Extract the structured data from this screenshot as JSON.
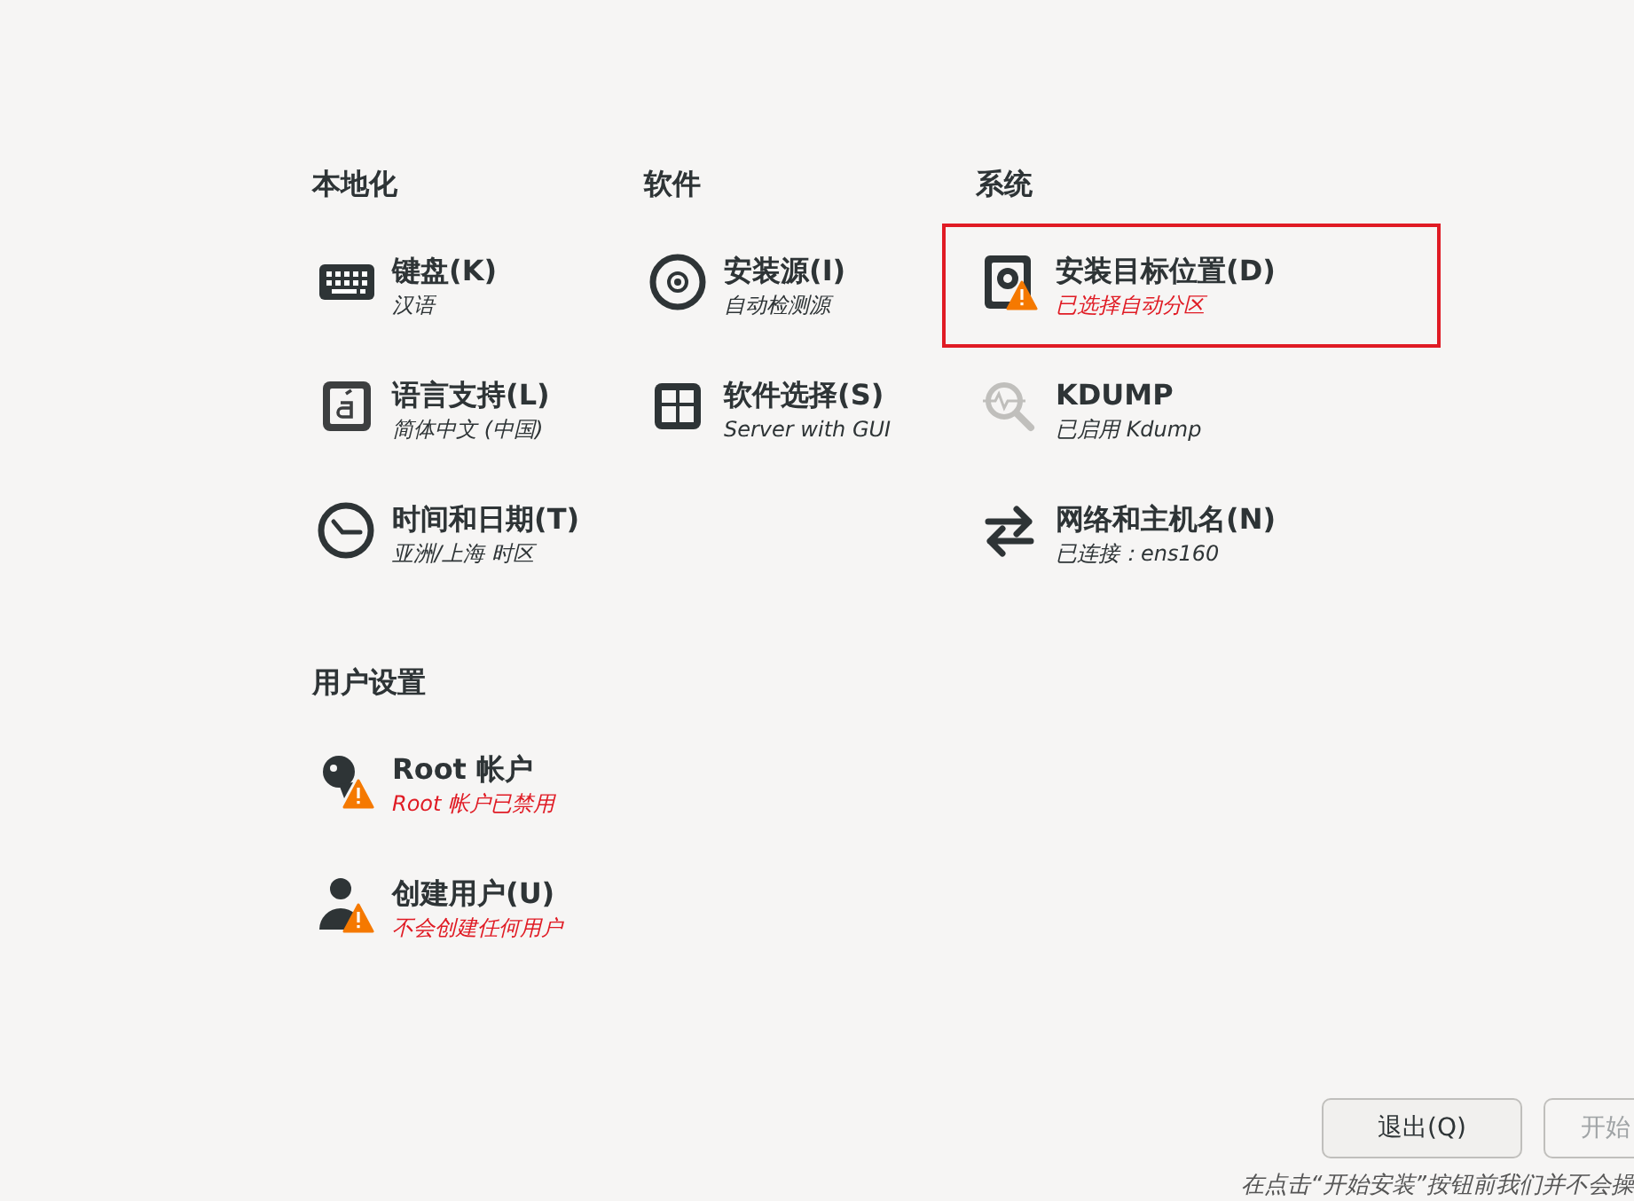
{
  "sections_row_1": [
    {
      "heading": "本地化",
      "items": [
        {
          "title": "键盘(K)",
          "status": "汉语",
          "warning": false,
          "selected": false
        },
        {
          "title": "语言支持(L)",
          "status": "简体中文 (中国)",
          "warning": false,
          "selected": false
        },
        {
          "title": "时间和日期(T)",
          "status": "亚洲/上海 时区",
          "warning": false,
          "selected": false
        }
      ]
    },
    {
      "heading": "软件",
      "items": [
        {
          "title": "安装源(I)",
          "status": "自动检测源",
          "warning": false,
          "selected": false
        },
        {
          "title": "软件选择(S)",
          "status": "Server with GUI",
          "warning": false,
          "selected": false
        }
      ]
    },
    {
      "heading": "系统",
      "items": [
        {
          "title": "安装目标位置(D)",
          "status": "已选择自动分区",
          "warning": true,
          "selected": true
        },
        {
          "title": "KDUMP",
          "status": "已启用 Kdump",
          "warning": false,
          "selected": false
        },
        {
          "title": "网络和主机名(N)",
          "status": "已连接：ens160",
          "warning": false,
          "selected": false
        }
      ]
    }
  ],
  "sections_row_2": [
    {
      "heading": "用户设置",
      "items": [
        {
          "title": "Root 帐户",
          "status": "Root 帐户已禁用",
          "warning": true,
          "selected": false
        },
        {
          "title": "创建用户(U)",
          "status": "不会创建任何用户",
          "warning": true,
          "selected": false
        }
      ]
    }
  ],
  "buttons": [
    {
      "label": "退出(Q)",
      "disabled": false
    },
    {
      "label": "开始",
      "disabled": true
    }
  ],
  "footer_note": "在点击“开始安装”按钮前我们并不会操"
}
